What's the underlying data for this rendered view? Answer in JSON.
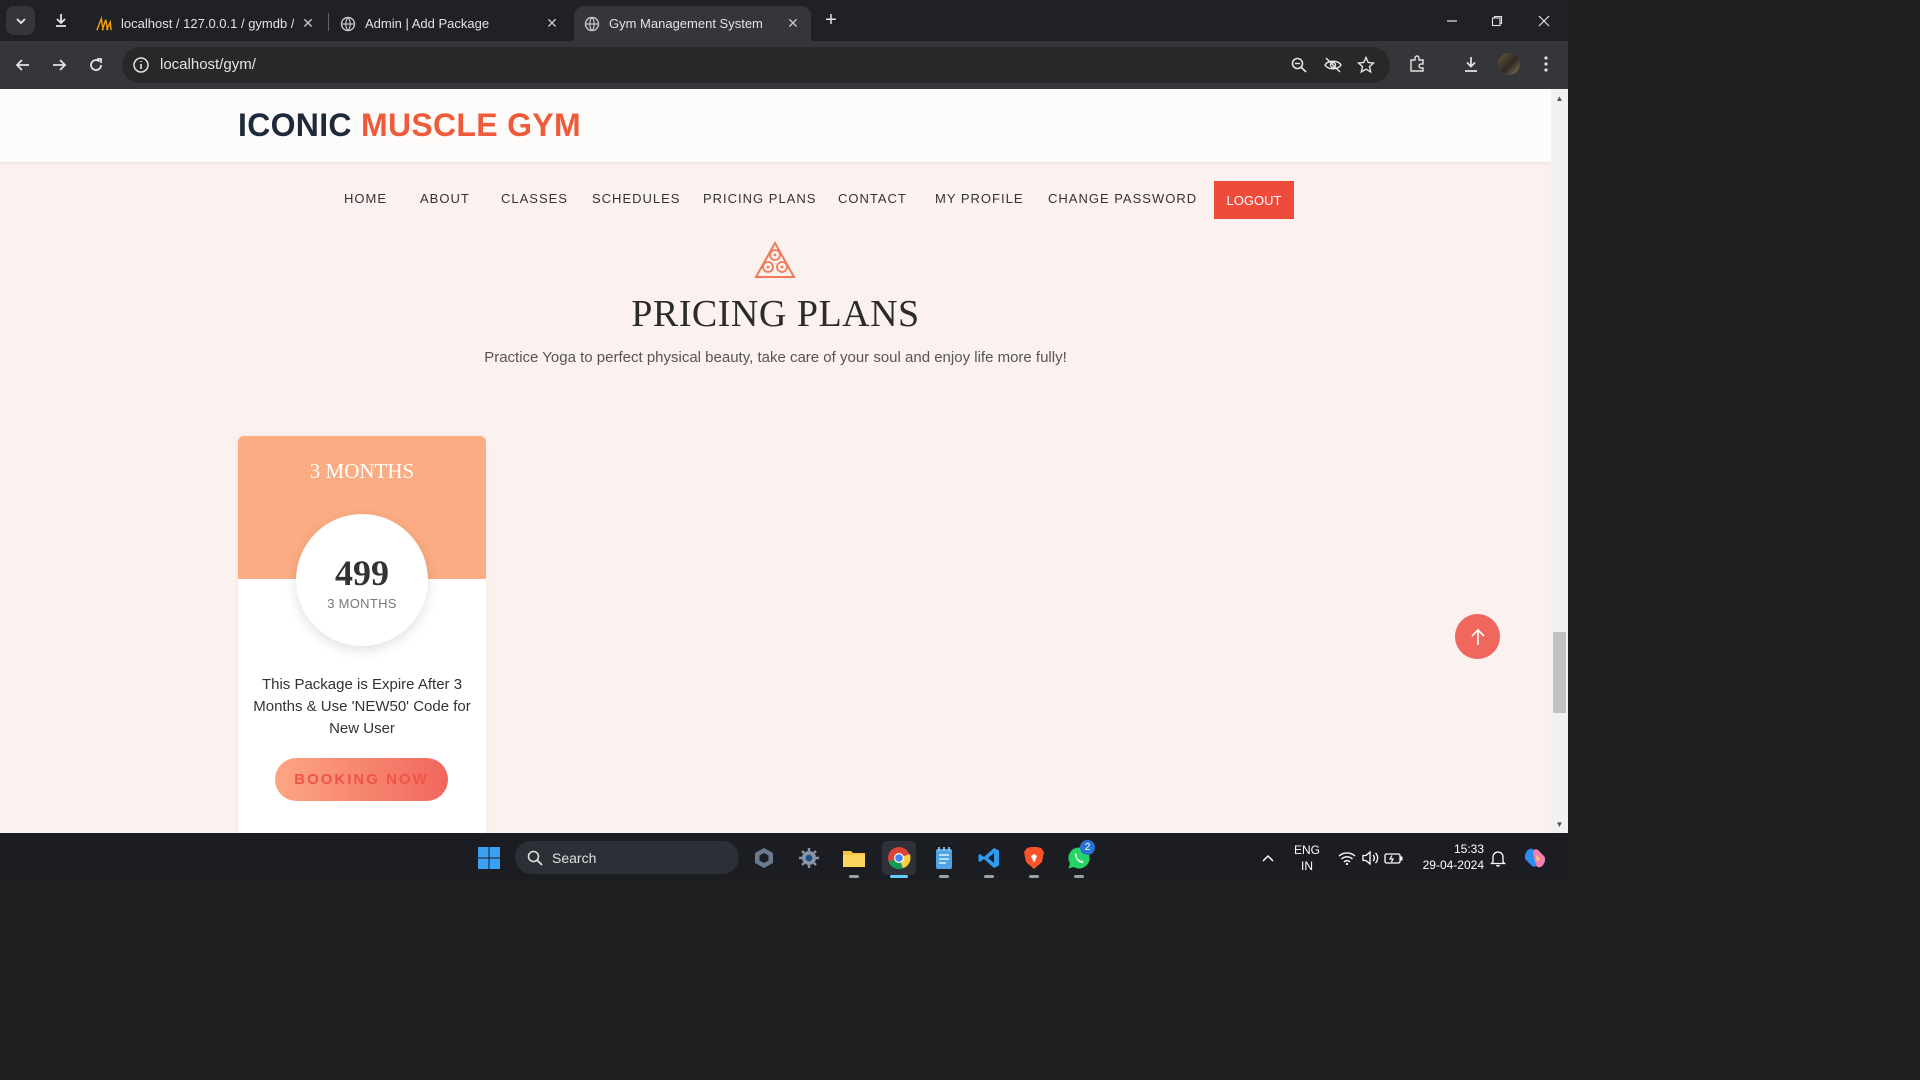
{
  "browser": {
    "tabs": [
      {
        "title": "localhost / 127.0.0.1 / gymdb /",
        "favicon": "phpmyadmin-icon",
        "active": false
      },
      {
        "title": "Admin | Add Package",
        "favicon": "globe-icon",
        "active": false
      },
      {
        "title": "Gym Management System",
        "favicon": "globe-icon",
        "active": true
      }
    ],
    "url": "localhost/gym/"
  },
  "site": {
    "logo_part1": "ICONIC",
    "logo_part2": "MUSCLE GYM",
    "nav": [
      "HOME",
      "ABOUT",
      "CLASSES",
      "SCHEDULES",
      "PRICING PLANS",
      "CONTACT",
      "MY PROFILE",
      "CHANGE PASSWORD"
    ],
    "logout_label": "LOGOUT",
    "colors": {
      "accent": "#ef5a3b",
      "card_header": "#fcac82",
      "page_bg": "#fbf1ef"
    }
  },
  "pricing": {
    "title": "PRICING PLANS",
    "subtitle": "Practice Yoga to perfect physical beauty, take care of your soul and enjoy life more fully!",
    "plans": [
      {
        "name": "3 MONTHS",
        "price": "499",
        "duration": "3 MONTHS",
        "description": "This Package is Expire After 3 Months & Use 'NEW50' Code for New User",
        "button": "BOOKING NOW"
      }
    ]
  },
  "taskbar": {
    "search_label": "Search",
    "language_line1": "ENG",
    "language_line2": "IN",
    "time": "15:33",
    "date": "29-04-2024",
    "whatsapp_badge": "2"
  }
}
